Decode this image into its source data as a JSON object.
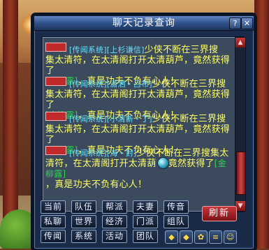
{
  "window": {
    "title": "聊天记录查询",
    "help_label": "?",
    "close_label": "✕"
  },
  "messages": [
    {
      "channel": "[传闻系统]",
      "sender": "[上杉谦信]",
      "text_a": "少侠不断在三界搜",
      "text_b": "集太清符，在太清阁打开太清葫芦，竟然获得了",
      "item": "[金柳露]",
      "text_c": "，真是功夫不负有心人！"
    },
    {
      "channel": "[传闻系统]",
      "sender": "[潇洒・吕布]",
      "text_a": "少侠不断在三界搜",
      "text_b": "集太清符，在太清阁打开太清葫芦，竟然获得了",
      "item": "[金柳露]",
      "text_c": "，真是功夫不负有心人！"
    },
    {
      "channel": "[传闻系统]",
      "sender": "[小清新・丁]",
      "text_a": "少侠不断在三界搜",
      "text_b": "集太清符，在太清阁打开太清葫芦，竟然获得了",
      "item": "[金柳露]",
      "text_c": "，真是功夫不负有心人！"
    },
    {
      "channel": "[传闻系统]",
      "sender": "[海・封]",
      "text_a": "少侠不断在三界搜集太",
      "text_b": "清符，在太清阁打开太清葫",
      "item": "[金柳露]",
      "text_c": "竟然获得了",
      "text_d": "，真是功夫不负有心人！"
    }
  ],
  "channels": [
    [
      "当前",
      "队伍",
      "帮派",
      "夫妻",
      "传音"
    ],
    [
      "私聊",
      "世界",
      "经济",
      "门派",
      "组队"
    ],
    [
      "传闻",
      "系统",
      "活动",
      "团队"
    ]
  ],
  "refresh_label": "刷新",
  "tools": [
    {
      "icon": "diamond-icon",
      "glyph": "◆"
    },
    {
      "icon": "diamond-icon",
      "glyph": "◆"
    },
    {
      "icon": "gear-icon",
      "glyph": "✿"
    },
    {
      "icon": "list-icon",
      "glyph": "≡"
    },
    {
      "icon": "smile-icon",
      "glyph": "☺"
    }
  ],
  "colors": {
    "message_text": "#ffff63",
    "system_tag": "#60e0ff",
    "item_link": "#2ad64a",
    "channel_tag": "#c02a2a"
  }
}
